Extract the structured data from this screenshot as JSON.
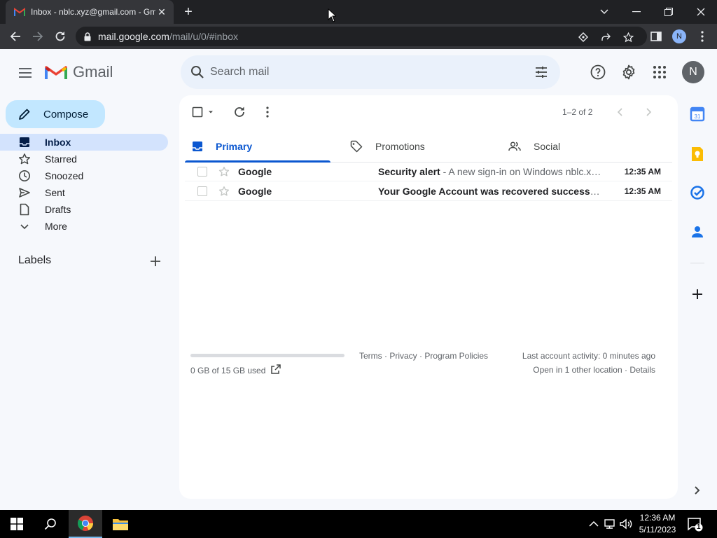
{
  "browser": {
    "tab_title": "Inbox - nblc.xyz@gmail.com - Gm",
    "url_host": "mail.google.com",
    "url_path": "/mail/u/0/#inbox",
    "profile_initial": "N"
  },
  "header": {
    "app_name": "Gmail",
    "search_placeholder": "Search mail",
    "avatar_initial": "N"
  },
  "sidebar": {
    "compose_label": "Compose",
    "items": [
      {
        "label": "Inbox",
        "active": true
      },
      {
        "label": "Starred"
      },
      {
        "label": "Snoozed"
      },
      {
        "label": "Sent"
      },
      {
        "label": "Drafts"
      },
      {
        "label": "More"
      }
    ],
    "labels_title": "Labels"
  },
  "toolbar": {
    "pager": "1–2 of 2"
  },
  "tabs": [
    {
      "label": "Primary",
      "active": true
    },
    {
      "label": "Promotions"
    },
    {
      "label": "Social"
    }
  ],
  "emails": [
    {
      "sender": "Google",
      "subject": "Security alert",
      "snippet": " - A new sign-in on Windows nblc.xyz@gmail.com",
      "time": "12:35 AM"
    },
    {
      "sender": "Google",
      "subject": "Your Google Account was recovered successfully",
      "snippet": "",
      "time": "12:35 AM"
    }
  ],
  "footer": {
    "storage_used": "0 GB of 15 GB used",
    "storage_fraction": 0.0,
    "links": "Terms · Privacy · Program Policies",
    "activity": "Last account activity: 0 minutes ago",
    "other_location": "Open in 1 other location · Details"
  },
  "taskbar": {
    "time": "12:36 AM",
    "date": "5/11/2023",
    "notification_count": "1"
  },
  "colors": {
    "accent": "#0b57d0",
    "compose_bg": "#c2e7ff",
    "active_nav": "#d3e3fd",
    "page_bg": "#f6f8fc"
  }
}
